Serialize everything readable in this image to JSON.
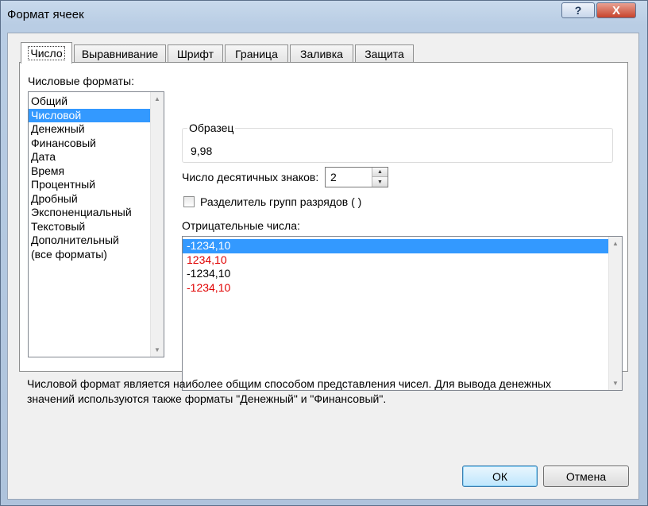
{
  "window": {
    "title": "Формат ячеек",
    "help_label": "?",
    "close_label": "X"
  },
  "tabs": [
    {
      "label": "Число",
      "active": true
    },
    {
      "label": "Выравнивание",
      "active": false
    },
    {
      "label": "Шрифт",
      "active": false
    },
    {
      "label": "Граница",
      "active": false
    },
    {
      "label": "Заливка",
      "active": false
    },
    {
      "label": "Защита",
      "active": false
    }
  ],
  "categories": {
    "label": "Числовые форматы:",
    "selected": "Числовой",
    "items": [
      "Общий",
      "Числовой",
      "Денежный",
      "Финансовый",
      "Дата",
      "Время",
      "Процентный",
      "Дробный",
      "Экспоненциальный",
      "Текстовый",
      "Дополнительный",
      "(все форматы)"
    ]
  },
  "sample": {
    "label": "Образец",
    "value": "9,98"
  },
  "decimals": {
    "label": "Число десятичных знаков:",
    "value": "2"
  },
  "separator": {
    "label": "Разделитель групп разрядов ( )",
    "checked": false
  },
  "negative": {
    "label": "Отрицательные числа:",
    "items": [
      {
        "text": "-1234,10",
        "color": "#000000",
        "selected": true
      },
      {
        "text": "1234,10",
        "color": "#e00000",
        "selected": false
      },
      {
        "text": "-1234,10",
        "color": "#000000",
        "selected": false
      },
      {
        "text": "-1234,10",
        "color": "#e00000",
        "selected": false
      }
    ]
  },
  "description": "Числовой формат является наиболее общим способом представления чисел. Для вывода денежных значений используются также форматы \"Денежный\" и \"Финансовый\".",
  "buttons": {
    "ok": "ОК",
    "cancel": "Отмена"
  },
  "colors": {
    "selection": "#3399ff",
    "negative_red": "#e00000"
  }
}
